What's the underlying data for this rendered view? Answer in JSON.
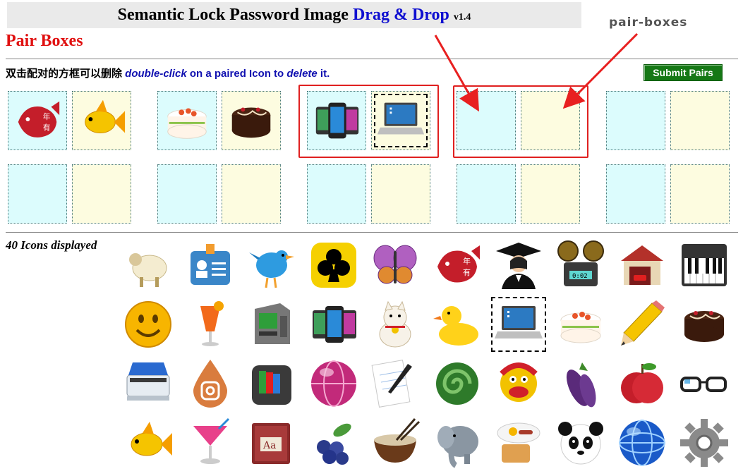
{
  "header": {
    "title_main": "Semantic Lock Password Image ",
    "title_accent": "Drag & Drop",
    "version": "v1.4"
  },
  "section_title": "Pair Boxes",
  "callout_label": "pair-boxes",
  "instructions": {
    "zh": "双击配对的方框可以删除 ",
    "part1": "double-click",
    "part2": " on a paired Icon to ",
    "part3": "delete",
    "part4": " it."
  },
  "submit_label": "Submit Pairs",
  "icons_count_label": "40 Icons displayed",
  "pair_boxes": [
    {
      "left_icon": "fish-stamp-icon",
      "right_icon": "goldfish-icon"
    },
    {
      "left_icon": "cake-icon",
      "right_icon": "chocolate-cake-icon"
    },
    {
      "left_icon": "smartphones-icon",
      "right_icon": "laptop-icon",
      "highlighted": true
    },
    {
      "left_icon": "",
      "right_icon": "",
      "highlighted": true
    },
    {
      "left_icon": "",
      "right_icon": ""
    },
    {
      "left_icon": "",
      "right_icon": ""
    },
    {
      "left_icon": "",
      "right_icon": ""
    },
    {
      "left_icon": "",
      "right_icon": ""
    },
    {
      "left_icon": "",
      "right_icon": ""
    },
    {
      "left_icon": "",
      "right_icon": ""
    }
  ],
  "icon_grid": [
    [
      "sheep-icon",
      "id-badge-icon",
      "twitter-bird-icon",
      "club-suit-icon",
      "butterfly-icon",
      "fish-stamp-icon",
      "graduate-icon",
      "film-projector-icon",
      "garage-icon",
      "piano-icon"
    ],
    [
      "smiley-icon",
      "cocktail-icon",
      "atm-icon",
      "smartphones-icon",
      "lucky-cat-icon",
      "rubber-duck-icon",
      "laptop-icon",
      "cake-icon",
      "pencil-icon",
      "chocolate-cake-icon"
    ],
    [
      "scanner-icon",
      "instagram-drop-icon",
      "wallet-icon",
      "globe-ball-icon",
      "notepad-pen-icon",
      "jade-spiral-icon",
      "lion-dance-icon",
      "eggplant-icon",
      "apple-icon",
      "glasses-icon"
    ],
    [
      "goldfish-icon",
      "martini-icon",
      "dictionary-icon",
      "blueberries-icon",
      "noodle-bowl-icon",
      "elephant-icon",
      "breakfast-icon",
      "panda-icon",
      "network-globe-icon",
      "gear-icon"
    ]
  ],
  "selected_icon": "laptop-icon",
  "colors": {
    "accent_blue": "#1010d0",
    "red": "#e01010",
    "green_button": "#157815",
    "slot_left": "#dcfcfd",
    "slot_right": "#fdfce0"
  }
}
